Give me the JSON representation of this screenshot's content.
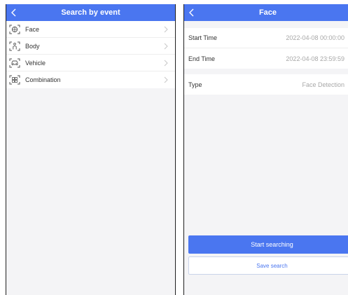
{
  "left": {
    "title": "Search by event",
    "items": [
      {
        "label": "Face",
        "icon": "face-scan-icon"
      },
      {
        "label": "Body",
        "icon": "body-scan-icon"
      },
      {
        "label": "Vehicle",
        "icon": "vehicle-scan-icon"
      },
      {
        "label": "Combination",
        "icon": "combination-scan-icon"
      }
    ]
  },
  "right": {
    "title": "Face",
    "fields": {
      "start_time": {
        "label": "Start Time",
        "value": "2022-04-08 00:00:00"
      },
      "end_time": {
        "label": "End Time",
        "value": "2022-04-08 23:59:59"
      },
      "type": {
        "label": "Type",
        "value": "Face Detection"
      }
    },
    "buttons": {
      "start": "Start searching",
      "save": "Save search"
    }
  },
  "colors": {
    "accent": "#4a76f0",
    "background": "#f4f4f6",
    "muted_text": "#a8a8a8"
  }
}
